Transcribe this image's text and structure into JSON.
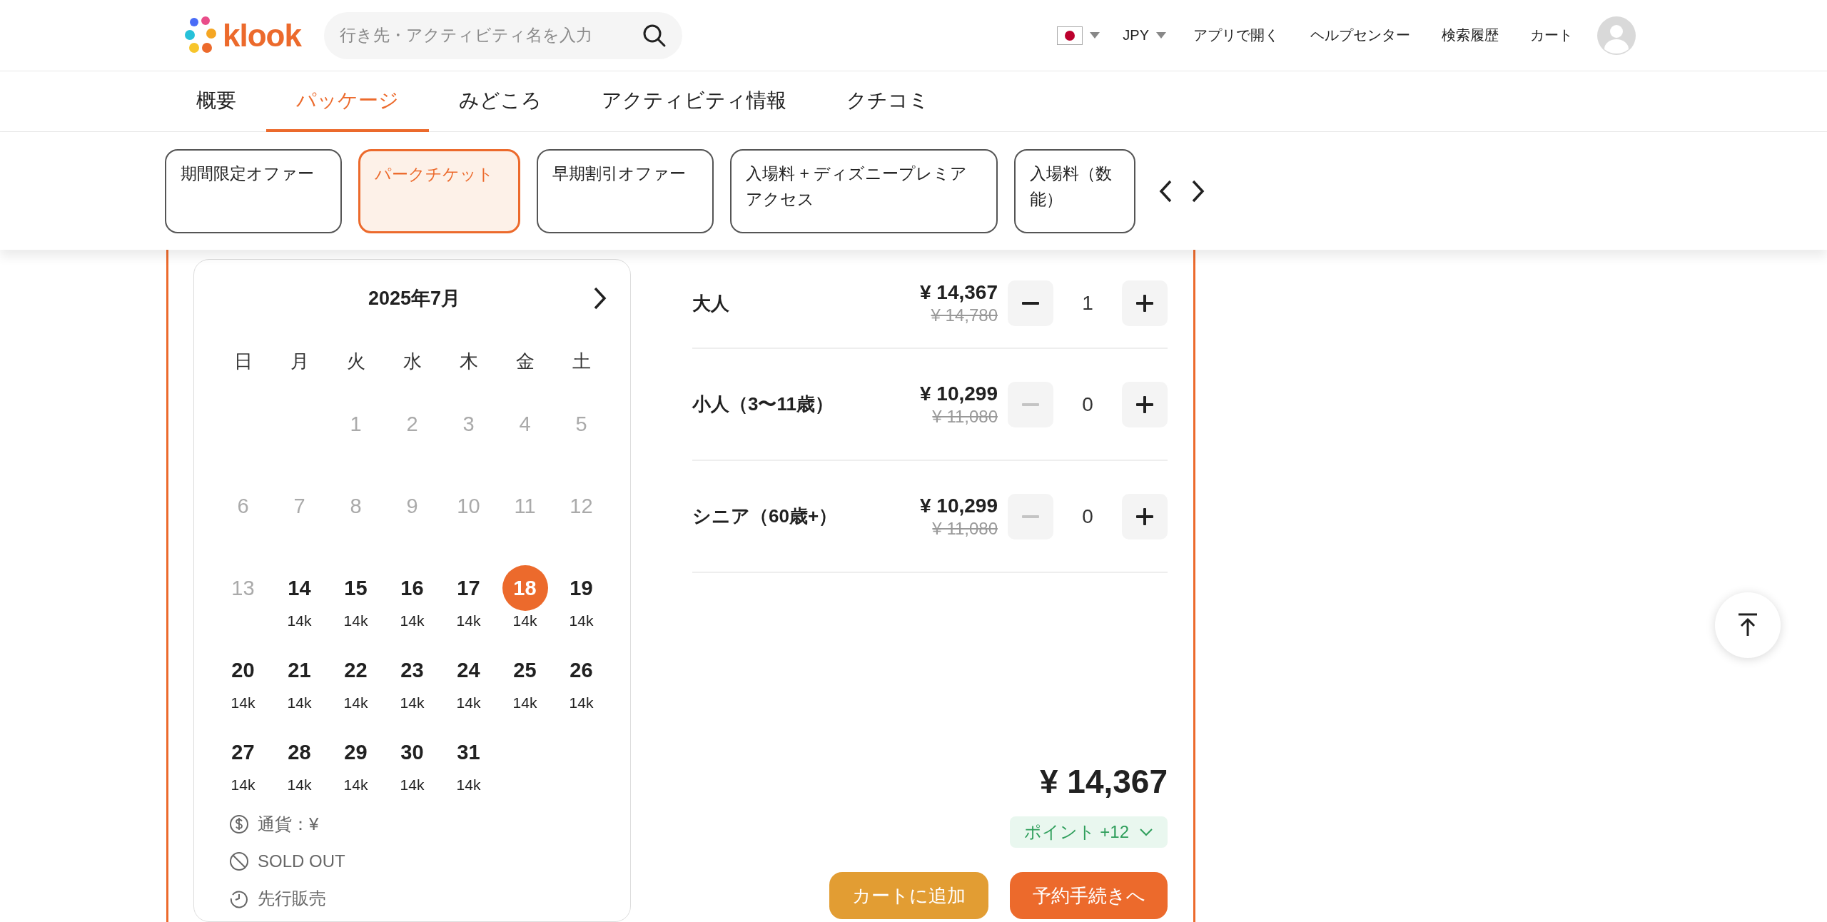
{
  "header": {
    "logo": "klook",
    "search": {
      "placeholder": "行き先・アクティビティ名を入力"
    },
    "currency": "JPY",
    "links": [
      "アプリで開く",
      "ヘルプセンター",
      "検索履歴",
      "カート"
    ]
  },
  "nav_tabs": [
    {
      "label": "概要",
      "selected": false
    },
    {
      "label": "パッケージ",
      "selected": true
    },
    {
      "label": "みどころ",
      "selected": false
    },
    {
      "label": "アクティビティ情報",
      "selected": false
    },
    {
      "label": "クチコミ",
      "selected": false
    }
  ],
  "packages": [
    {
      "label": "期間限定オファー",
      "selected": false
    },
    {
      "label": "パークチケット",
      "selected": true
    },
    {
      "label": "早期割引オファー",
      "selected": false
    },
    {
      "label": "入場料 + ディズニープレミアアクセス",
      "selected": false
    },
    {
      "label": "入場料（数能）",
      "selected": false
    }
  ],
  "calendar": {
    "month": "2025年7月",
    "weekdays": [
      "日",
      "月",
      "火",
      "水",
      "木",
      "金",
      "土"
    ],
    "weeks": [
      [
        {
          "kind": "blank"
        },
        {
          "kind": "blank"
        },
        {
          "kind": "day",
          "day": "1",
          "available": false,
          "selected": false
        },
        {
          "kind": "day",
          "day": "2",
          "available": false,
          "selected": false
        },
        {
          "kind": "day",
          "day": "3",
          "available": false,
          "selected": false
        },
        {
          "kind": "day",
          "day": "4",
          "available": false,
          "selected": false
        },
        {
          "kind": "day",
          "day": "5",
          "available": false,
          "selected": false
        }
      ],
      [
        {
          "kind": "day",
          "day": "6",
          "available": false,
          "selected": false
        },
        {
          "kind": "day",
          "day": "7",
          "available": false,
          "selected": false
        },
        {
          "kind": "day",
          "day": "8",
          "available": false,
          "selected": false
        },
        {
          "kind": "day",
          "day": "9",
          "available": false,
          "selected": false
        },
        {
          "kind": "day",
          "day": "10",
          "available": false,
          "selected": false
        },
        {
          "kind": "day",
          "day": "11",
          "available": false,
          "selected": false
        },
        {
          "kind": "day",
          "day": "12",
          "available": false,
          "selected": false
        }
      ],
      [
        {
          "kind": "day",
          "day": "13",
          "available": false,
          "selected": false
        },
        {
          "kind": "day",
          "day": "14",
          "price": "14k",
          "available": true,
          "selected": false
        },
        {
          "kind": "day",
          "day": "15",
          "price": "14k",
          "available": true,
          "selected": false
        },
        {
          "kind": "day",
          "day": "16",
          "price": "14k",
          "available": true,
          "selected": false
        },
        {
          "kind": "day",
          "day": "17",
          "price": "14k",
          "available": true,
          "selected": false
        },
        {
          "kind": "day",
          "day": "18",
          "price": "14k",
          "available": true,
          "selected": true
        },
        {
          "kind": "day",
          "day": "19",
          "price": "14k",
          "available": true,
          "selected": false
        }
      ],
      [
        {
          "kind": "day",
          "day": "20",
          "price": "14k",
          "available": true,
          "selected": false
        },
        {
          "kind": "day",
          "day": "21",
          "price": "14k",
          "available": true,
          "selected": false
        },
        {
          "kind": "day",
          "day": "22",
          "price": "14k",
          "available": true,
          "selected": false
        },
        {
          "kind": "day",
          "day": "23",
          "price": "14k",
          "available": true,
          "selected": false
        },
        {
          "kind": "day",
          "day": "24",
          "price": "14k",
          "available": true,
          "selected": false
        },
        {
          "kind": "day",
          "day": "25",
          "price": "14k",
          "available": true,
          "selected": false
        },
        {
          "kind": "day",
          "day": "26",
          "price": "14k",
          "available": true,
          "selected": false
        }
      ],
      [
        {
          "kind": "day",
          "day": "27",
          "price": "14k",
          "available": true,
          "selected": false
        },
        {
          "kind": "day",
          "day": "28",
          "price": "14k",
          "available": true,
          "selected": false
        },
        {
          "kind": "day",
          "day": "29",
          "price": "14k",
          "available": true,
          "selected": false
        },
        {
          "kind": "day",
          "day": "30",
          "price": "14k",
          "available": true,
          "selected": false
        },
        {
          "kind": "day",
          "day": "31",
          "price": "14k",
          "available": true,
          "selected": false
        },
        {
          "kind": "blank"
        },
        {
          "kind": "blank"
        }
      ]
    ],
    "legend": [
      {
        "kind": "currency",
        "text": "通貨：¥"
      },
      {
        "kind": "sold_out",
        "text": "SOLD OUT"
      },
      {
        "kind": "presale",
        "text": "先行販売"
      }
    ]
  },
  "tickets": [
    {
      "name": "大人",
      "price": "¥ 14,367",
      "original_price": "¥ 14,780",
      "quantity": "1",
      "decrement_disabled": false
    },
    {
      "name": "小人（3〜11歳）",
      "price": "¥ 10,299",
      "original_price": "¥ 11,080",
      "quantity": "0",
      "decrement_disabled": true
    },
    {
      "name": "シニア（60歳+）",
      "price": "¥ 10,299",
      "original_price": "¥ 11,080",
      "quantity": "0",
      "decrement_disabled": true
    }
  ],
  "total": "¥ 14,367",
  "points": "ポイント +12",
  "buttons": [
    {
      "kind": "cart",
      "label": "カートに追加"
    },
    {
      "kind": "book",
      "label": "予約手続きへ"
    }
  ]
}
